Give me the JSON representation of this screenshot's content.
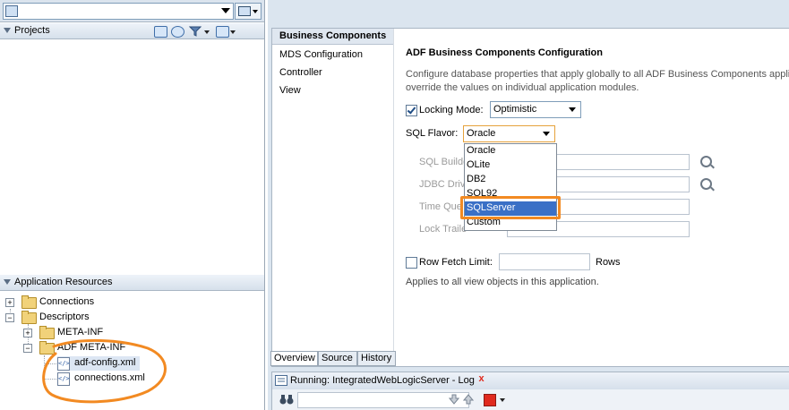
{
  "left": {
    "projects": {
      "title": "Projects"
    },
    "app_resources": {
      "title": "Application Resources",
      "items": {
        "connections": "Connections",
        "descriptors": "Descriptors",
        "meta_inf": "META-INF",
        "adf_meta_inf": "ADF META-INF",
        "adf_config": "adf-config.xml",
        "connections_xml": "connections.xml"
      }
    }
  },
  "editor": {
    "nav": {
      "header": "Business Components",
      "items": [
        "MDS Configuration",
        "Controller",
        "View"
      ]
    },
    "content": {
      "title": "ADF Business Components Configuration",
      "desc_line1": "Configure database properties that apply globally to all ADF Business Components applica",
      "desc_line2": "override the values on individual application modules.",
      "locking_mode": {
        "label": "Locking Mode:",
        "value": "Optimistic",
        "checked": true
      },
      "sql_flavor": {
        "label": "SQL Flavor:",
        "value": "Oracle",
        "options": [
          "Oracle",
          "OLite",
          "DB2",
          "SQL92",
          "SQLServer",
          "Custom"
        ],
        "highlighted": "SQLServer"
      },
      "disabled_labels": {
        "sql_builder": "SQL Builde",
        "jdbc_driver": "JDBC Drive",
        "time_query": "Time Que",
        "lock_trailer": "Lock Traile"
      },
      "row_fetch": {
        "label": "Row Fetch Limit:",
        "unit": "Rows",
        "checked": false
      },
      "applies_text": "Applies to all view objects in this application."
    },
    "tabs": [
      "Overview",
      "Source",
      "History"
    ]
  },
  "log": {
    "title": "Running: IntegratedWebLogicServer - Log",
    "close_glyph": "x"
  },
  "colors": {
    "highlight_orange": "#f28a22",
    "selection_blue": "#3a70c6",
    "stop_red": "#e02a1e"
  }
}
